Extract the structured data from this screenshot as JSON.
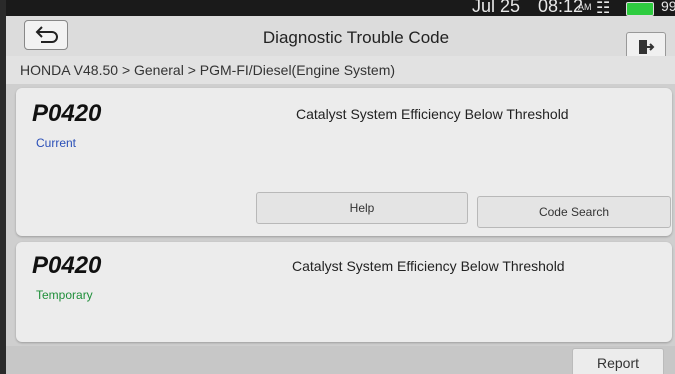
{
  "status": {
    "date": "Jul 25",
    "time": "08:12",
    "ampm": "AM",
    "battery": "99"
  },
  "header": {
    "title": "Diagnostic Trouble Code"
  },
  "breadcrumb": "HONDA V48.50 > General > PGM-FI/Diesel(Engine System)",
  "codes": [
    {
      "code": "P0420",
      "description": "Catalyst System Efficiency Below Threshold",
      "state": "Current",
      "state_color": "#2a4fb8"
    },
    {
      "code": "P0420",
      "description": "Catalyst System Efficiency Below Threshold",
      "state": "Temporary",
      "state_color": "#1f8f3a"
    }
  ],
  "buttons": {
    "help": "Help",
    "code_search": "Code Search",
    "report": "Report"
  }
}
